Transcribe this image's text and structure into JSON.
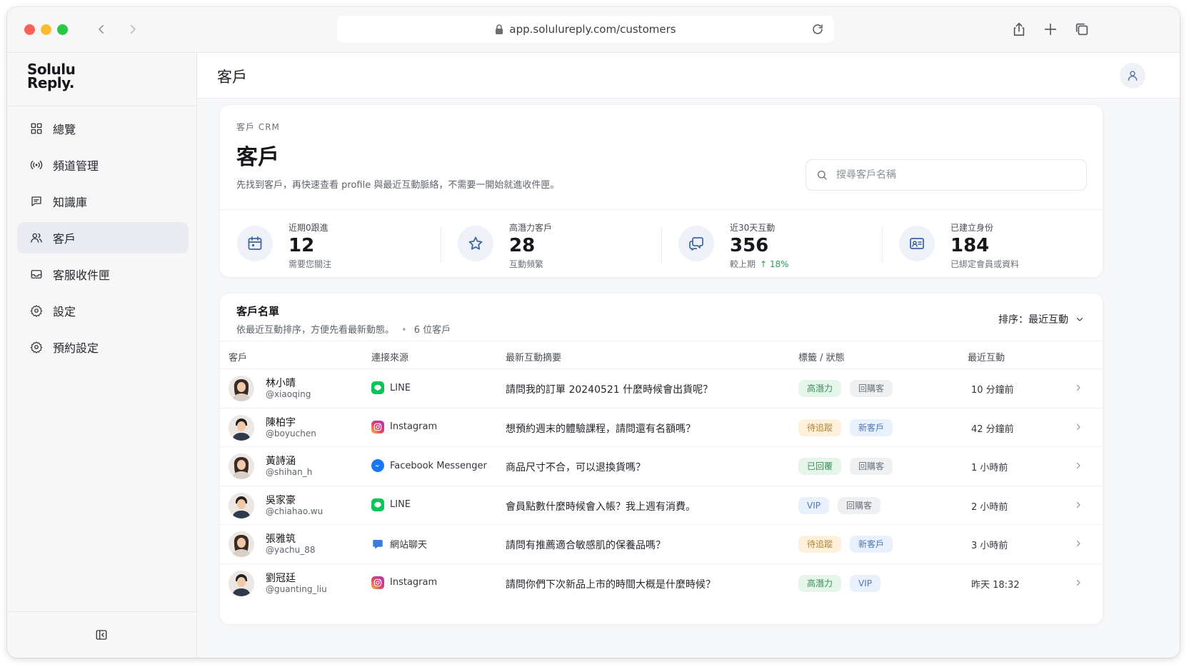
{
  "browser": {
    "url": "app.solulureply.com/customers"
  },
  "brand": {
    "logo_line1": "Solulu",
    "logo_line2": "Reply."
  },
  "sidebar": {
    "items": [
      {
        "label": "總覽",
        "icon": "grid-icon"
      },
      {
        "label": "頻道管理",
        "icon": "broadcast-icon"
      },
      {
        "label": "知識庫",
        "icon": "message-square-icon"
      },
      {
        "label": "客戶",
        "icon": "users-icon",
        "active": true
      },
      {
        "label": "客服收件匣",
        "icon": "inbox-icon"
      },
      {
        "label": "設定",
        "icon": "gear-icon"
      },
      {
        "label": "預約設定",
        "icon": "gear-icon"
      }
    ]
  },
  "header": {
    "title": "客戶"
  },
  "hero": {
    "eyebrow": "客戶 CRM",
    "title": "客戶",
    "description": "先找到客戶，再快速查看 profile 與最近互動脈絡，不需要一開始就進收件匣。",
    "search_placeholder": "搜尋客戶名稱"
  },
  "stats": [
    {
      "label": "近期0跟進",
      "value": "12",
      "sub": "需要您關注",
      "icon": "calendar-icon"
    },
    {
      "label": "高潛力客戶",
      "value": "28",
      "sub": "互動頻繁",
      "icon": "star-icon"
    },
    {
      "label": "近30天互動",
      "value": "356",
      "sub": "較上期",
      "trend": "↑ 18%",
      "icon": "chat-bubbles-icon"
    },
    {
      "label": "已建立身份",
      "value": "184",
      "sub": "已綁定會員或資料",
      "icon": "id-card-icon"
    }
  ],
  "list": {
    "title": "客戶名單",
    "subtitle": "依最近互動排序，方便先看最新動態。",
    "count": "6 位客戶",
    "sort_label": "排序：最近互動",
    "columns": [
      "客戶",
      "連接來源",
      "最新互動摘要",
      "標籤 / 狀態",
      "最近互動"
    ],
    "rows": [
      {
        "name": "林小晴",
        "handle": "@xiaoqing",
        "channel": "LINE",
        "channel_icon": "line-icon",
        "summary": "請問我的訂單 20240521 什麼時候會出貨呢？",
        "tags": [
          {
            "label": "高潛力",
            "kind": "green"
          },
          {
            "label": "回購客",
            "kind": "gray"
          }
        ],
        "time": "10 分鐘前",
        "gender": "f"
      },
      {
        "name": "陳柏宇",
        "handle": "@boyuchen",
        "channel": "Instagram",
        "channel_icon": "instagram-icon",
        "summary": "想預約週末的體驗課程，請問還有名額嗎？",
        "tags": [
          {
            "label": "待追蹤",
            "kind": "orange"
          },
          {
            "label": "新客戶",
            "kind": "blue"
          }
        ],
        "time": "42 分鐘前",
        "gender": "m"
      },
      {
        "name": "黃詩涵",
        "handle": "@shihan_h",
        "channel": "Facebook Messenger",
        "channel_icon": "messenger-icon",
        "summary": "商品尺寸不合，可以退換貨嗎？",
        "tags": [
          {
            "label": "已回覆",
            "kind": "green"
          },
          {
            "label": "回購客",
            "kind": "gray"
          }
        ],
        "time": "1 小時前",
        "gender": "f"
      },
      {
        "name": "吳家豪",
        "handle": "@chiahao.wu",
        "channel": "LINE",
        "channel_icon": "line-icon",
        "summary": "會員點數什麼時候會入帳？我上週有消費。",
        "tags": [
          {
            "label": "VIP",
            "kind": "blue"
          },
          {
            "label": "回購客",
            "kind": "gray"
          }
        ],
        "time": "2 小時前",
        "gender": "m"
      },
      {
        "name": "張雅筑",
        "handle": "@yachu_88",
        "channel": "網站聊天",
        "channel_icon": "web-chat-icon",
        "summary": "請問有推薦適合敏感肌的保養品嗎？",
        "tags": [
          {
            "label": "待追蹤",
            "kind": "orange"
          },
          {
            "label": "新客戶",
            "kind": "blue"
          }
        ],
        "time": "3 小時前",
        "gender": "f"
      },
      {
        "name": "劉冠廷",
        "handle": "@guanting_liu",
        "channel": "Instagram",
        "channel_icon": "instagram-icon",
        "summary": "請問你們下次新品上市的時間大概是什麼時候？",
        "tags": [
          {
            "label": "高潛力",
            "kind": "green"
          },
          {
            "label": "VIP",
            "kind": "blue"
          }
        ],
        "time": "昨天 18:32",
        "gender": "m"
      }
    ]
  },
  "colors": {
    "tag_green_bg": "#e5f5ea",
    "tag_green_fg": "#3d8d58",
    "tag_gray_bg": "#eef0f2",
    "tag_gray_fg": "#6b7079",
    "tag_orange_bg": "#fdf1dc",
    "tag_orange_fg": "#b98432",
    "tag_blue_bg": "#e8f0fb",
    "tag_blue_fg": "#4f78b8",
    "line": "#06c755",
    "messenger": "#1877f2",
    "web_chat": "#3b7ddd"
  }
}
